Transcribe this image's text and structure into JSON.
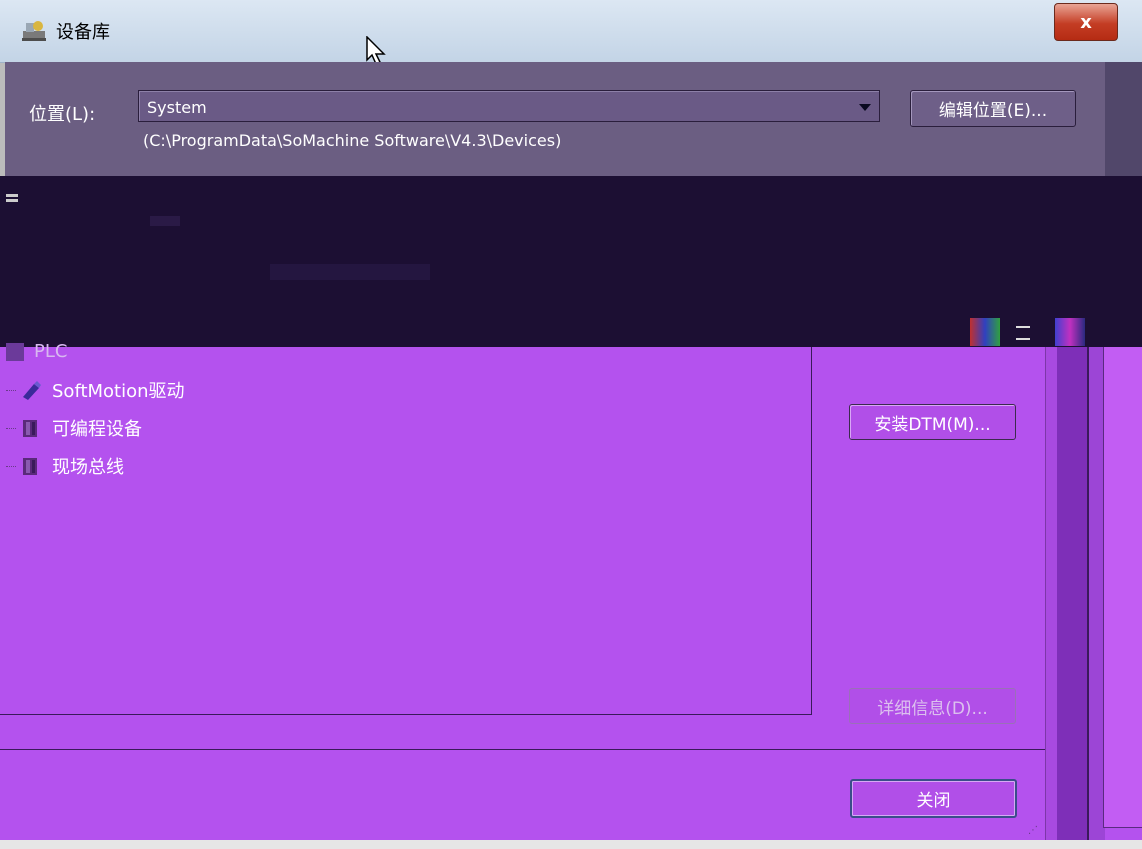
{
  "window": {
    "title": "设备库",
    "close_label": "x"
  },
  "location": {
    "label": "位置(L):",
    "selected": "System",
    "path": "(C:\\ProgramData\\SoMachine Software\\V4.3\\Devices)",
    "edit_button": "编辑位置(E)..."
  },
  "tree": {
    "partial_item": "PLC",
    "items": [
      {
        "label": "SoftMotion驱动",
        "icon": "softmotion-drive-icon"
      },
      {
        "label": "可编程设备",
        "icon": "programmable-device-icon"
      },
      {
        "label": "现场总线",
        "icon": "fieldbus-icon"
      }
    ]
  },
  "buttons": {
    "install_dtm": "安装DTM(M)...",
    "details": "详细信息(D)...",
    "close": "关闭"
  },
  "colors": {
    "main_bg": "#b452ee",
    "dark_band": "#1c0f33",
    "location_bg": "#6b5e82",
    "close_red": "#c43d24"
  }
}
